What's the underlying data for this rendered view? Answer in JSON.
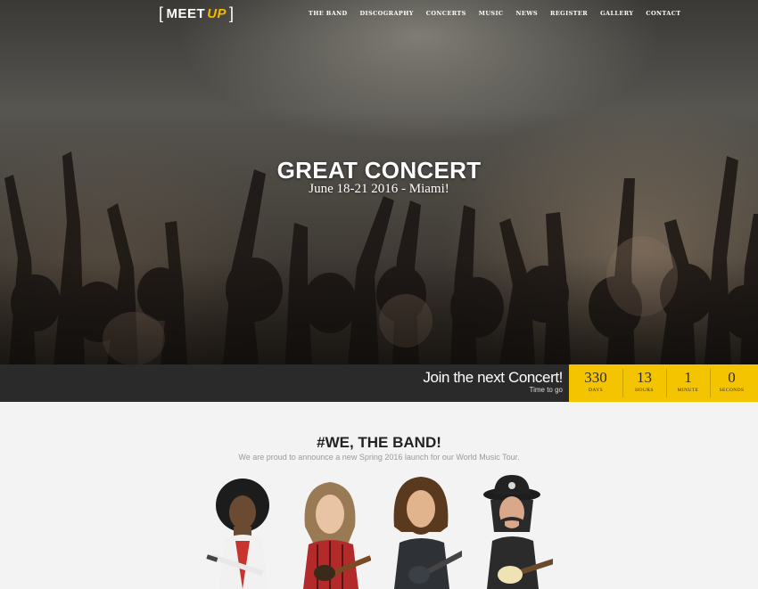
{
  "logo": {
    "open_bracket": "[",
    "meet": "MEET",
    "up": "UP",
    "close_bracket": "]"
  },
  "nav": {
    "items": [
      {
        "label": "THE BAND"
      },
      {
        "label": "DISCOGRAPHY"
      },
      {
        "label": "CONCERTS"
      },
      {
        "label": "MUSIC"
      },
      {
        "label": "NEWS"
      },
      {
        "label": "REGISTER"
      },
      {
        "label": "GALLERY"
      },
      {
        "label": "CONTACT"
      }
    ]
  },
  "hero": {
    "title": "GREAT CONCERT",
    "subtitle": "June 18-21 2016 - Miami!"
  },
  "countdown": {
    "title": "Join the next Concert!",
    "subtitle": "Time to go",
    "days": {
      "value": "330",
      "label": "DAYS"
    },
    "hours": {
      "value": "13",
      "label": "HOURS"
    },
    "minutes": {
      "value": "1",
      "label": "MINUTE"
    },
    "seconds": {
      "value": "0",
      "label": "SECONDS"
    }
  },
  "band": {
    "title": "#WE, THE BAND!",
    "text": "We are proud to announce a new Spring 2016 launch for our World Music Tour."
  },
  "colors": {
    "accent": "#f5c400",
    "countbar": "#2a2a2a",
    "section_bg": "#f3f3f3"
  }
}
